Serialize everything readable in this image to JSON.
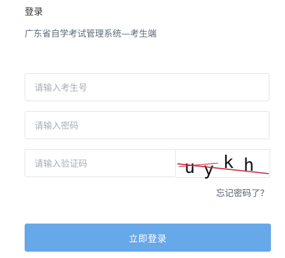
{
  "header": {
    "title": "登录",
    "subtitle": "广东省自学考试管理系统—考生端"
  },
  "form": {
    "exam_no_placeholder": "请输入考生号",
    "password_placeholder": "请输入密码",
    "captcha_placeholder": "请输入验证码",
    "captcha_text": "uykh"
  },
  "links": {
    "forgot_password": "忘记密码了？"
  },
  "actions": {
    "login_label": "立即登录"
  },
  "colors": {
    "button": "#66a8e8",
    "field_border": "#e3e6ea",
    "captcha_noise_line": "#c9243f"
  }
}
